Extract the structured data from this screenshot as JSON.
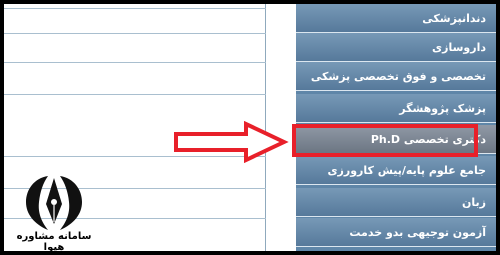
{
  "menu": {
    "items": [
      {
        "label": "دندانپزشکی"
      },
      {
        "label": "داروسازی"
      },
      {
        "label": "تخصصی و فوق تخصصی پزشکی"
      },
      {
        "label": "پزشک پژوهشگر"
      },
      {
        "label": "دکتری تخصصی Ph.D"
      },
      {
        "label": "جامع علوم پایه/پیش کارورزی"
      },
      {
        "label": "زبان"
      },
      {
        "label": "آزمون توجیهی بدو خدمت"
      }
    ],
    "active_index": 4
  },
  "logo": {
    "caption": "سامانه مشاوره هپوا"
  },
  "colors": {
    "menu_bg": "#5f86a8",
    "active_bg": "#7f8895",
    "highlight": "#e8202a",
    "frame": "#000000"
  }
}
